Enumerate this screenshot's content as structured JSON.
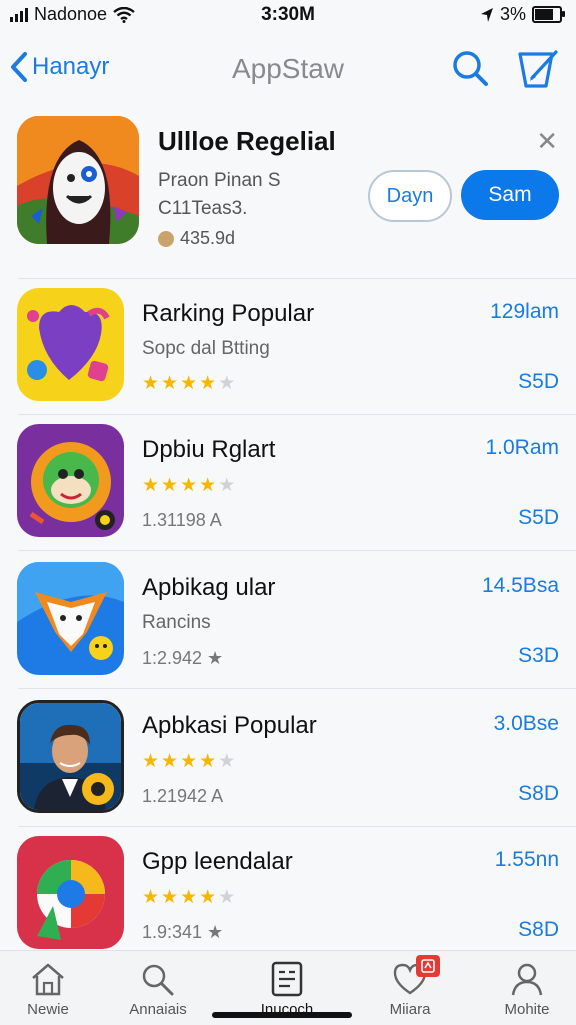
{
  "status": {
    "carrier": "Nadonoe",
    "time": "3:30M",
    "battery": "3%"
  },
  "nav": {
    "back_label": "Hanayr",
    "title": "AppStaw"
  },
  "featured": {
    "title": "Ullloe Regelial",
    "sub1": "Praon Pinan S",
    "sub2": "C11Teas3.",
    "rating": "435.9d",
    "button_outline": "Dayn",
    "button_solid": "Sam"
  },
  "apps": [
    {
      "name": "Rarking Popular",
      "line2": "Sopc dal Btting",
      "size": "129lam",
      "price": "S5D",
      "rating_count": "",
      "stars": 3.5
    },
    {
      "name": "Dpbiu Rglart",
      "line2": "",
      "size": "1.0Ram",
      "price": "S5D",
      "rating_count": "1.31198 A",
      "stars": 4.5
    },
    {
      "name": "Apbikag ular",
      "line2": "Rancins",
      "size": "14.5Bsa",
      "price": "S3D",
      "rating_count": "1:2.942 ★",
      "stars": 0
    },
    {
      "name": "Apbkasi Popular",
      "line2": "",
      "size": "3.0Bse",
      "price": "S8D",
      "rating_count": "1.21942 A",
      "stars": 4.5
    },
    {
      "name": "Gpp leendalar",
      "line2": "",
      "size": "1.55nn",
      "price": "S8D",
      "rating_count": "1.9:341 ★",
      "stars": 4.5
    }
  ],
  "tabs": [
    {
      "label": "Newie"
    },
    {
      "label": "Annaiais"
    },
    {
      "label": "Inucoch"
    },
    {
      "label": "Miiara",
      "badge": ""
    },
    {
      "label": "Mohite"
    }
  ],
  "colors": {
    "accent": "#0b79ea",
    "star": "#f5b800"
  }
}
